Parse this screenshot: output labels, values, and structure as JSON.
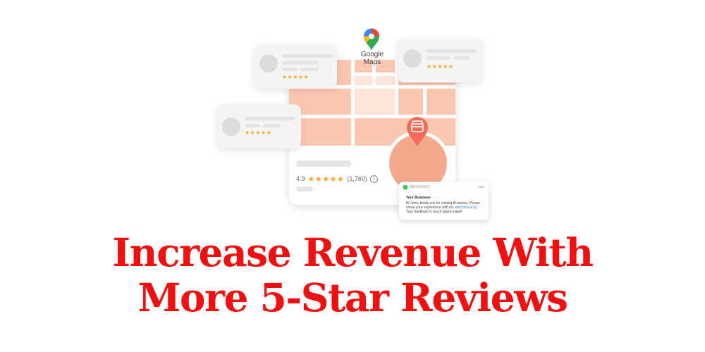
{
  "logo": {
    "label": "Google Maps",
    "icon": "google-maps-pin-icon"
  },
  "listing": {
    "rating": "4.9",
    "stars": "★★★★★",
    "review_count": "(1,760)",
    "info_glyph": "i"
  },
  "review_cards": [
    {
      "stars": "★★★★★"
    },
    {
      "stars": "★★★★★"
    },
    {
      "stars": "★★★★★"
    }
  ],
  "message": {
    "app": "MESSAGES",
    "time": "now",
    "title": "Your Business",
    "body_start": "Hi John, thank you for visiting Business. Please share your experience with us: ",
    "link": "start.bz/xyz7g",
    "body_end": " Your feedback is much appreciated!"
  },
  "headline": {
    "line1": "Increase Revenue With",
    "line2": "More 5-Star Reviews"
  },
  "colors": {
    "headline": "#ee1111",
    "map_fill": "#f9c7b2",
    "pin": "#f26b5b",
    "star": "#f5a623"
  }
}
